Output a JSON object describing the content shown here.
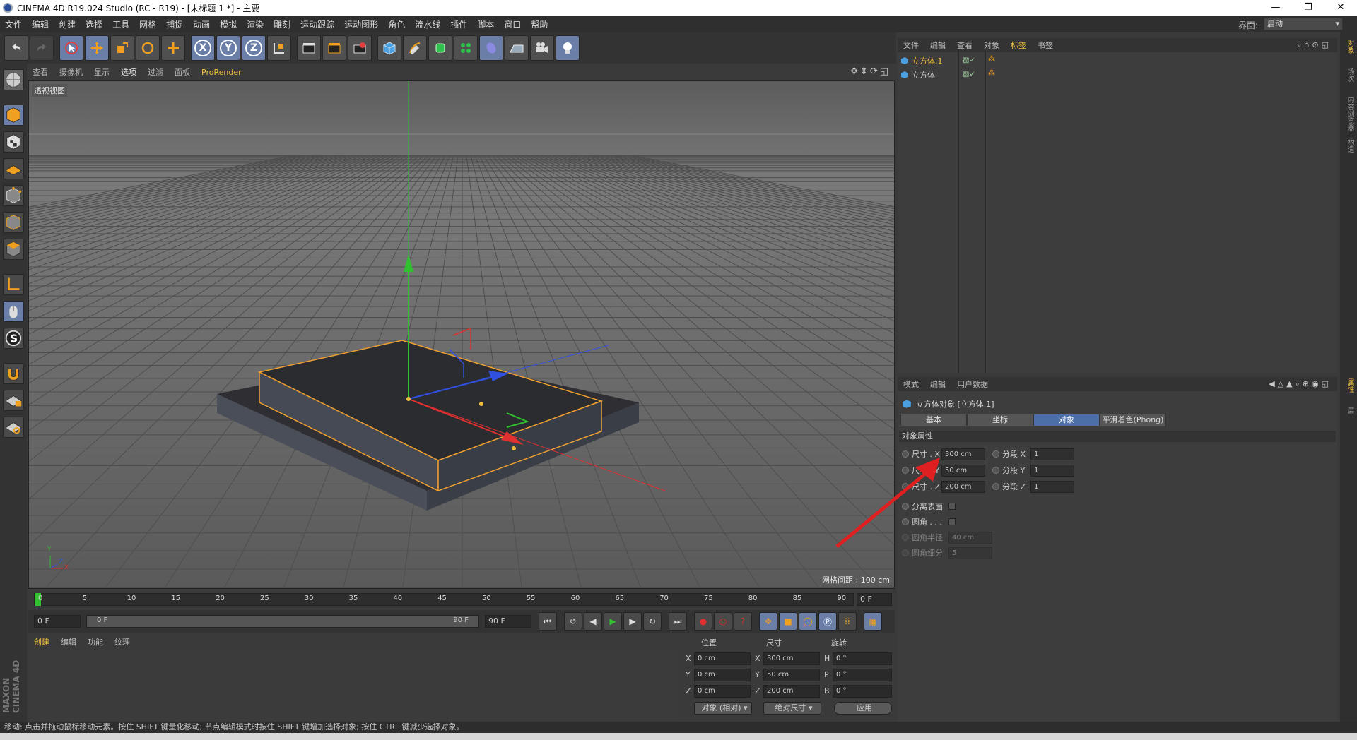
{
  "window": {
    "title": "CINEMA 4D R19.024 Studio (RC - R19) - [未标题 1 *] - 主要",
    "min": "—",
    "max": "❐",
    "close": "✕"
  },
  "menu": {
    "items": [
      "文件",
      "编辑",
      "创建",
      "选择",
      "工具",
      "网格",
      "捕捉",
      "动画",
      "模拟",
      "渲染",
      "雕刻",
      "运动跟踪",
      "运动图形",
      "角色",
      "流水线",
      "插件",
      "脚本",
      "窗口",
      "帮助"
    ],
    "layout_label": "界面:",
    "layout_value": "启动"
  },
  "toolbar": {
    "axis_x": "X",
    "axis_y": "Y",
    "axis_z": "Z"
  },
  "viewport": {
    "menu": [
      "查看",
      "摄像机",
      "显示",
      "选项",
      "过滤",
      "面板"
    ],
    "prorender": "ProRender",
    "label": "透视视图",
    "grid_spacing": "网格间距 : 100 cm",
    "axis_y": "Y",
    "axis_x": "X",
    "axis_z": "Z"
  },
  "timeline": {
    "ticks": [
      "0",
      "5",
      "10",
      "15",
      "20",
      "25",
      "30",
      "35",
      "40",
      "45",
      "50",
      "55",
      "60",
      "65",
      "70",
      "75",
      "80",
      "85",
      "90"
    ],
    "current_frame": "0 F"
  },
  "transport": {
    "start": "0 F",
    "range_start": "0 F",
    "range_end": "90 F",
    "end": "90 F"
  },
  "material": {
    "menu": [
      "创建",
      "编辑",
      "功能",
      "纹理"
    ]
  },
  "coord": {
    "headers": {
      "pos": "位置",
      "size": "尺寸",
      "rot": "旋转"
    },
    "rows": [
      {
        "axis": "X",
        "pos": "0 cm",
        "saxis": "X",
        "size": "300 cm",
        "raxis": "H",
        "rot": "0 °"
      },
      {
        "axis": "Y",
        "pos": "0 cm",
        "saxis": "Y",
        "size": "50 cm",
        "raxis": "P",
        "rot": "0 °"
      },
      {
        "axis": "Z",
        "pos": "0 cm",
        "saxis": "Z",
        "size": "200 cm",
        "raxis": "B",
        "rot": "0 °"
      }
    ],
    "mode": "对象 (相对)",
    "size_mode": "绝对尺寸",
    "apply": "应用"
  },
  "objmgr": {
    "menu": [
      "文件",
      "编辑",
      "查看",
      "对象",
      "标签",
      "书签"
    ],
    "objects": [
      {
        "name": "立方体.1",
        "selected": true
      },
      {
        "name": "立方体",
        "selected": false
      }
    ]
  },
  "attr": {
    "menu": [
      "模式",
      "编辑",
      "用户数据"
    ],
    "object_title": "立方体对象 [立方体.1]",
    "tabs": [
      "基本",
      "坐标",
      "对象",
      "平滑着色(Phong)"
    ],
    "active_tab": 2,
    "section": "对象属性",
    "size_x_label": "尺寸 . X",
    "size_x": "300 cm",
    "size_y_label": "尺寸 . Y",
    "size_y": "50 cm",
    "size_z_label": "尺寸 . Z",
    "size_z": "200 cm",
    "seg_x_label": "分段 X",
    "seg_x": "1",
    "seg_y_label": "分段 Y",
    "seg_y": "1",
    "seg_z_label": "分段 Z",
    "seg_z": "1",
    "separate_surfaces": "分离表面",
    "fillet": "圆角 . . .",
    "fillet_radius_label": "圆角半径",
    "fillet_radius": "40 cm",
    "fillet_sub_label": "圆角细分",
    "fillet_sub": "5"
  },
  "statusbar": {
    "text": "移动: 点击并拖动鼠标移动元素。按住 SHIFT 键量化移动; 节点编辑模式时按住 SHIFT 键增加选择对象; 按住 CTRL 键减少选择对象。"
  },
  "right_tabs": [
    "对象",
    "场次",
    "内容浏览器",
    "构造",
    "属性",
    "层"
  ],
  "brand": "MAXON CINEMA 4D",
  "colors": {
    "accent": "#4d6fa8",
    "highlight": "#f0c040",
    "selection_orange": "#f0a030",
    "axis_red": "#e03030",
    "axis_green": "#30c030",
    "axis_blue": "#3050e0"
  }
}
